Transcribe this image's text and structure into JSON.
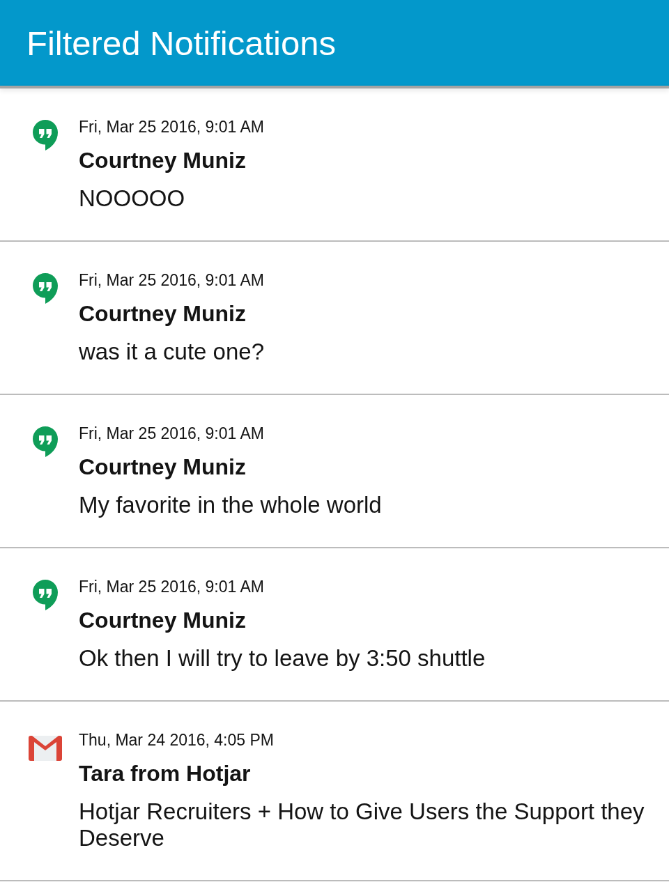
{
  "header": {
    "title": "Filtered Notifications"
  },
  "notifications": [
    {
      "kind": "hangouts",
      "date": "Fri, Mar 25 2016, 9:01 AM",
      "sender": "Courtney Muniz",
      "message": "NOOOOO"
    },
    {
      "kind": "hangouts",
      "date": "Fri, Mar 25 2016, 9:01 AM",
      "sender": "Courtney Muniz",
      "message": "was it a cute one?"
    },
    {
      "kind": "hangouts",
      "date": "Fri, Mar 25 2016, 9:01 AM",
      "sender": "Courtney Muniz",
      "message": "My favorite in the whole world"
    },
    {
      "kind": "hangouts",
      "date": "Fri, Mar 25 2016, 9:01 AM",
      "sender": "Courtney Muniz",
      "message": "Ok then I will try to leave by 3:50 shuttle"
    },
    {
      "kind": "gmail",
      "date": "Thu, Mar 24 2016, 4:05 PM",
      "sender": "Tara from Hotjar",
      "message": "Hotjar Recruiters + How to Give Users the Support they Deserve"
    }
  ]
}
